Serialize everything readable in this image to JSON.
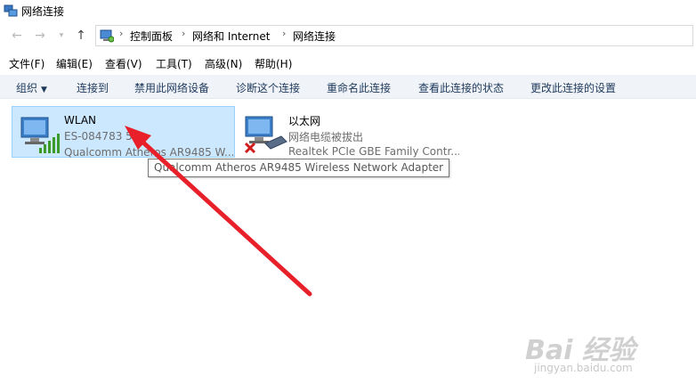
{
  "window": {
    "title": "网络连接"
  },
  "address": {
    "crumbs": [
      "控制面板",
      "网络和 Internet",
      "网络连接"
    ]
  },
  "menu": [
    "文件(F)",
    "编辑(E)",
    "查看(V)",
    "工具(T)",
    "高级(N)",
    "帮助(H)"
  ],
  "commands": {
    "organize": "组织",
    "items": [
      "连接到",
      "禁用此网络设备",
      "诊断这个连接",
      "重命名此连接",
      "查看此连接的状态",
      "更改此连接的设置"
    ]
  },
  "connections": [
    {
      "name": "WLAN",
      "status": "ES-084783  5",
      "device": "Qualcomm Atheros AR9485 W..."
    },
    {
      "name": "以太网",
      "status": "网络电缆被拔出",
      "device": "Realtek PCIe GBE Family Contr..."
    }
  ],
  "tooltip": "Qualcomm Atheros AR9485 Wireless Network Adapter",
  "watermark": {
    "text": "Bai 经验",
    "url": "jingyan.baidu.com"
  },
  "colors": {
    "selection_bg": "#cce8ff",
    "selection_border": "#99d1ff",
    "command_text": "#1e395b",
    "arrow": "#e8202a"
  }
}
